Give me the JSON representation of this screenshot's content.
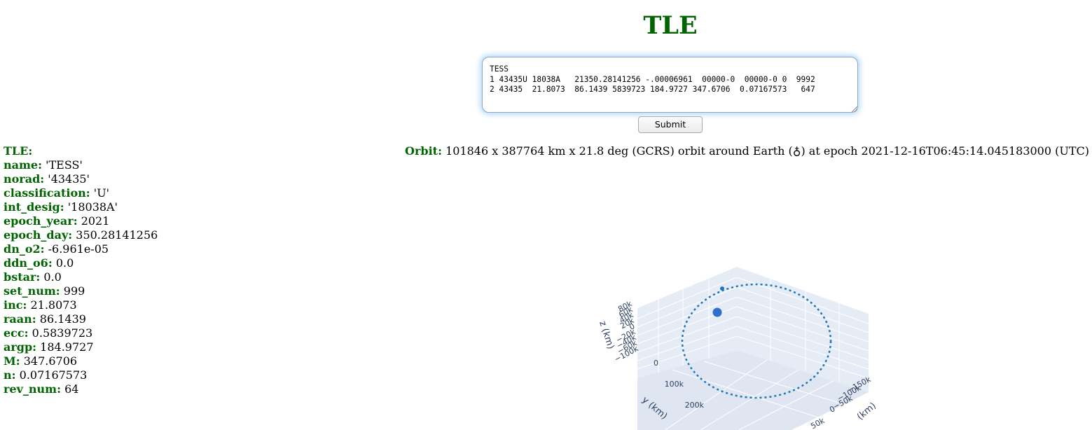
{
  "page": {
    "title": "TLE"
  },
  "tle_input": {
    "text": "TESS\n1 43435U 18038A   21350.28141256 -.00006961  00000-0  00000-0 0  9992\n2 43435  21.8073  86.1439 5839723 184.9727 347.6706  0.07167573   647",
    "submit_label": "Submit"
  },
  "orbit": {
    "label": "Orbit:",
    "text": "101846 x 387764 km x 21.8 deg (GCRS) orbit around Earth (♁) at epoch 2021-12-16T06:45:14.045183000 (UTC)"
  },
  "fields": [
    {
      "key": "TLE:",
      "value": ""
    },
    {
      "key": "name:",
      "value": "'TESS'"
    },
    {
      "key": "norad:",
      "value": "'43435'"
    },
    {
      "key": "classification:",
      "value": "'U'"
    },
    {
      "key": "int_desig:",
      "value": "'18038A'"
    },
    {
      "key": "epoch_year:",
      "value": "2021"
    },
    {
      "key": "epoch_day:",
      "value": "350.28141256"
    },
    {
      "key": "dn_o2:",
      "value": "-6.961e-05"
    },
    {
      "key": "ddn_o6:",
      "value": "0.0"
    },
    {
      "key": "bstar:",
      "value": "0.0"
    },
    {
      "key": "set_num:",
      "value": "999"
    },
    {
      "key": "inc:",
      "value": "21.8073"
    },
    {
      "key": "raan:",
      "value": "86.1439"
    },
    {
      "key": "ecc:",
      "value": "0.5839723"
    },
    {
      "key": "argp:",
      "value": "184.9727"
    },
    {
      "key": "M:",
      "value": "347.6706"
    },
    {
      "key": "n:",
      "value": "0.07167573"
    },
    {
      "key": "rev_num:",
      "value": "64"
    }
  ],
  "plot": {
    "z_axis_title": "z (km)",
    "y_axis_title": "y (km)",
    "x_axis_title": "(km)",
    "z_ticks": [
      "80k",
      "60k",
      "40k",
      "20k",
      "0",
      "−20k",
      "−40k",
      "−60k",
      "−100k"
    ],
    "y_ticks": [
      "0",
      "100k",
      "200k"
    ],
    "x_ticks": [
      "−150k",
      "−100k",
      "−50k",
      "0",
      "50k"
    ],
    "colors": {
      "orbit": "#1f77b4",
      "scene_bg": "#e5ecf6",
      "title_green": "#006400"
    }
  }
}
